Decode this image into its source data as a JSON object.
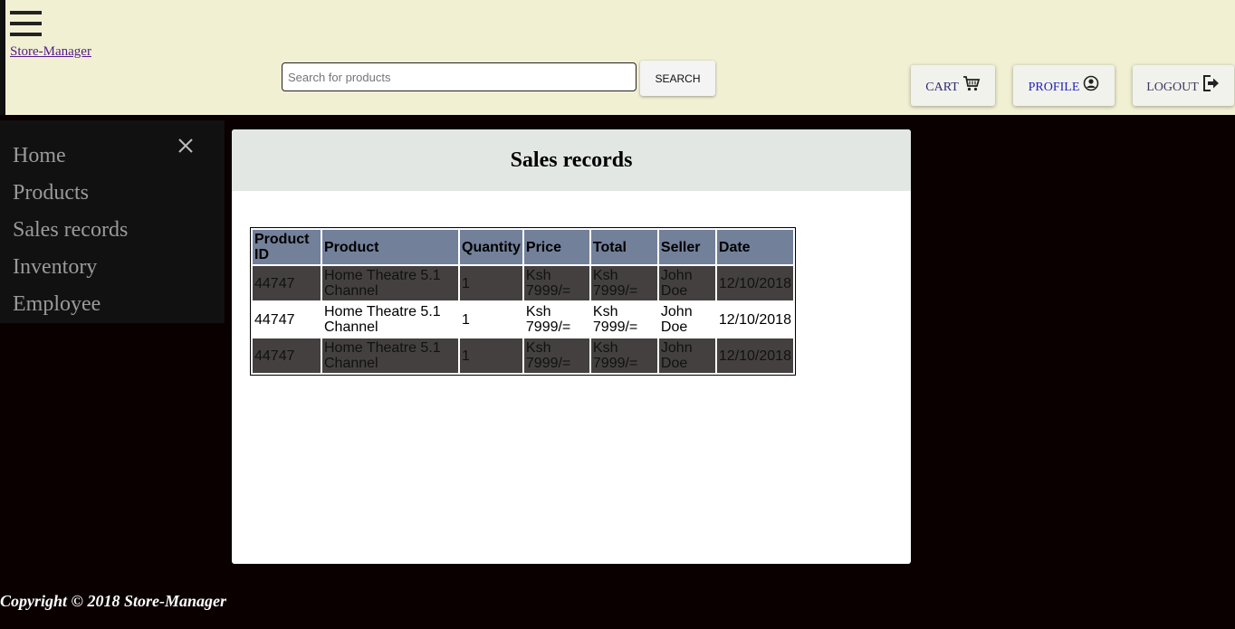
{
  "header": {
    "brand": "Store-Manager",
    "search": {
      "placeholder": "Search for products",
      "button": "SEARCH"
    },
    "nav": {
      "cart": "CART",
      "profile": "PROFILE",
      "logout": "LOGOUT"
    }
  },
  "sidebar": {
    "items": [
      {
        "label": "Home"
      },
      {
        "label": "Products"
      },
      {
        "label": "Sales records"
      },
      {
        "label": "Inventory"
      },
      {
        "label": "Employee"
      }
    ]
  },
  "main": {
    "title": "Sales records",
    "table": {
      "headers": [
        "Product ID",
        "Product",
        "Quantity",
        "Price",
        "Total",
        "Seller",
        "Date"
      ],
      "rows": [
        [
          "44747",
          "Home Theatre 5.1 Channel",
          "1",
          "Ksh 7999/=",
          "Ksh 7999/=",
          "John Doe",
          "12/10/2018"
        ],
        [
          "44747",
          "Home Theatre 5.1 Channel",
          "1",
          "Ksh 7999/=",
          "Ksh 7999/=",
          "John Doe",
          "12/10/2018"
        ],
        [
          "44747",
          "Home Theatre 5.1 Channel",
          "1",
          "Ksh 7999/=",
          "Ksh 7999/=",
          "John Doe",
          "12/10/2018"
        ]
      ]
    }
  },
  "footer": {
    "text": "Copyright © 2018 Store-Manager"
  },
  "icons": {
    "menu": "hamburger-menu-icon",
    "cart": "cart-icon",
    "profile": "user-circle-icon",
    "logout": "sign-out-icon",
    "close": "close-icon"
  },
  "colors": {
    "header_bg": "#f1f0d3",
    "page_bg": "#0a0000",
    "sidebar_bg": "#111111",
    "table_header_bg": "#73809a",
    "table_dark_row": "#444040",
    "card_header_bg": "#e3e7e4"
  }
}
